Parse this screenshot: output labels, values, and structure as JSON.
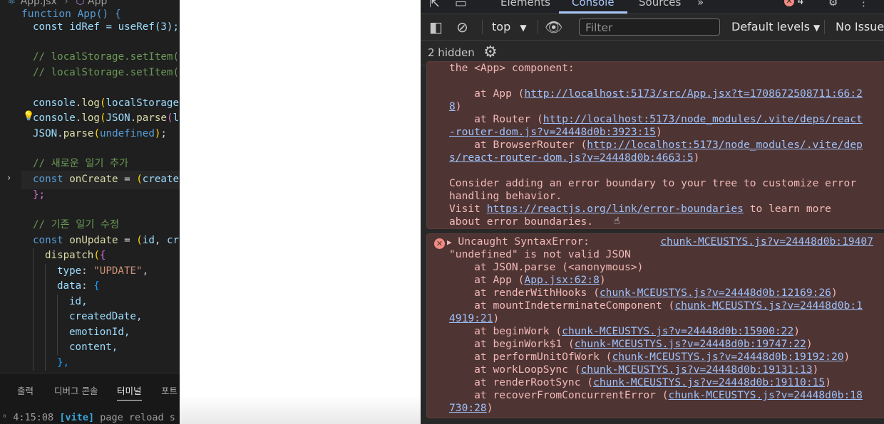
{
  "editor": {
    "tab_file": "App.jsx",
    "tab_breadcrumb": "App",
    "sticky_header": "function App() {",
    "lines": {
      "l1": "const idRef = useRef(3);",
      "l2": "// localStorage.setItem(",
      "l3": "// localStorage.setItem(",
      "l4a": "console",
      "l4b": "log",
      "l4c": "localStorage",
      "l5a": "console",
      "l5b": "log",
      "l5c": "JSON",
      "l5d": "parse",
      "l5e": "l",
      "l6a": "JSON",
      "l6b": "parse",
      "l6c": "undefined",
      "l7": "// 새로운 일기 추가",
      "l8a": "const",
      "l8b": "onCreate",
      "l8c": "create",
      "l9": "};",
      "l10": "// 기존 일기 수정",
      "l11a": "const",
      "l11b": "onUpdate",
      "l11c": "id",
      "l11d": "cr",
      "l12": "dispatch",
      "l13a": "type",
      "l13b": "\"UPDATE\"",
      "l14": "data",
      "l15": "id,",
      "l16": "createdDate,",
      "l17": "emotionId,",
      "l18": "content,",
      "l19": "},"
    },
    "panel_tabs": [
      "출력",
      "디버그 콘솔",
      "터미널",
      "포트"
    ],
    "terminal": {
      "time": "4:15:08",
      "tag": "[vite]",
      "text": "page reload s"
    }
  },
  "devtools": {
    "tabs": [
      "Elements",
      "Console",
      "Sources"
    ],
    "error_count": "4",
    "toolbar": {
      "context": "top",
      "filter_placeholder": "Filter",
      "levels": "Default levels",
      "issues": "No Issues"
    },
    "hidden_text": "2 hidden",
    "message1": {
      "line0": "the <App> component:",
      "at_app": "    at App (",
      "link_app_1": "http://localhost:5173/src/App.jsx?t=1708672508711:66:2",
      "link_app_2": "8",
      "link_app_close": ")",
      "at_router": "    at Router (",
      "link_router_1": "http://localhost:5173/node_modules/.vite/deps/react",
      "link_router_2": "-router-dom.js?v=24448d0b:3923:15",
      "at_browser": "    at BrowserRouter (",
      "link_browser_1": "http://localhost:5173/node_modules/.vite/dep",
      "link_browser_2": "s/react-router-dom.js?v=24448d0b:4663:5",
      "consider_1": "Consider adding an error boundary to your tree to customize error",
      "consider_2": "handling behavior.",
      "visit": "Visit ",
      "visit_link": "https://reactjs.org/link/error-boundaries",
      "visit_rest": " to learn more",
      "about": "about error boundaries."
    },
    "message2": {
      "title": "Uncaught SyntaxError:",
      "source": "chunk-MCEUSTYS.js?v=24448d0b:19407",
      "line1": "\"undefined\" is not valid JSON",
      "stack": [
        {
          "pre": "    at JSON.parse (<anonymous>)",
          "link": "",
          "post": ""
        },
        {
          "pre": "    at App (",
          "link": "App.jsx:62:8",
          "post": ")"
        },
        {
          "pre": "    at renderWithHooks (",
          "link": "chunk-MCEUSTYS.js?v=24448d0b:12169:26",
          "post": ")"
        },
        {
          "pre": "    at mountIndeterminateComponent (",
          "link": "chunk-MCEUSTYS.js?v=24448d0b:1",
          "post": ""
        },
        {
          "pre": "",
          "link": "4919:21",
          "post": ")"
        },
        {
          "pre": "    at beginWork (",
          "link": "chunk-MCEUSTYS.js?v=24448d0b:15900:22",
          "post": ")"
        },
        {
          "pre": "    at beginWork$1 (",
          "link": "chunk-MCEUSTYS.js?v=24448d0b:19747:22",
          "post": ")"
        },
        {
          "pre": "    at performUnitOfWork (",
          "link": "chunk-MCEUSTYS.js?v=24448d0b:19192:20",
          "post": ")"
        },
        {
          "pre": "    at workLoopSync (",
          "link": "chunk-MCEUSTYS.js?v=24448d0b:19131:13",
          "post": ")"
        },
        {
          "pre": "    at renderRootSync (",
          "link": "chunk-MCEUSTYS.js?v=24448d0b:19110:15",
          "post": ")"
        },
        {
          "pre": "    at recoverFromConcurrentError (",
          "link": "chunk-MCEUSTYS.js?v=24448d0b:18",
          "post": ""
        },
        {
          "pre": "",
          "link": "730:28",
          "post": ")"
        }
      ]
    }
  }
}
